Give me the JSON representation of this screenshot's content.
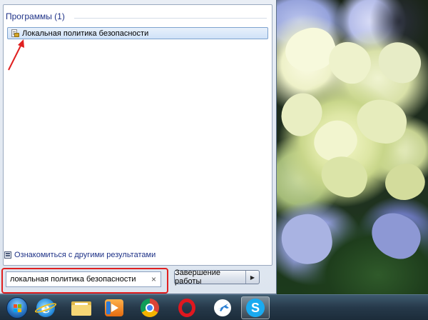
{
  "start_menu": {
    "section_title": "Программы (1)",
    "result_item_label": "Локальная политика безопасности",
    "more_results_label": "Ознакомиться с другими результатами",
    "search_value": "локальная политика безопасности",
    "search_clear": "×",
    "shutdown_label": "Завершение работы",
    "shutdown_arrow": "▶"
  },
  "taskbar": {
    "items": [
      {
        "name": "start-button",
        "icon": "windows-orb-icon"
      },
      {
        "name": "internet-explorer",
        "icon": "ie-icon",
        "glyph": "e"
      },
      {
        "name": "file-explorer",
        "icon": "folder-icon"
      },
      {
        "name": "media-player",
        "icon": "media-player-icon"
      },
      {
        "name": "chrome",
        "icon": "chrome-icon"
      },
      {
        "name": "opera",
        "icon": "opera-icon"
      },
      {
        "name": "airplane-app",
        "icon": "airplane-icon"
      },
      {
        "name": "skype",
        "icon": "skype-icon",
        "glyph": "S"
      }
    ]
  },
  "colors": {
    "highlight_red": "#e02020",
    "section_title_blue": "#1e3287",
    "taskbar": "#26394a"
  }
}
